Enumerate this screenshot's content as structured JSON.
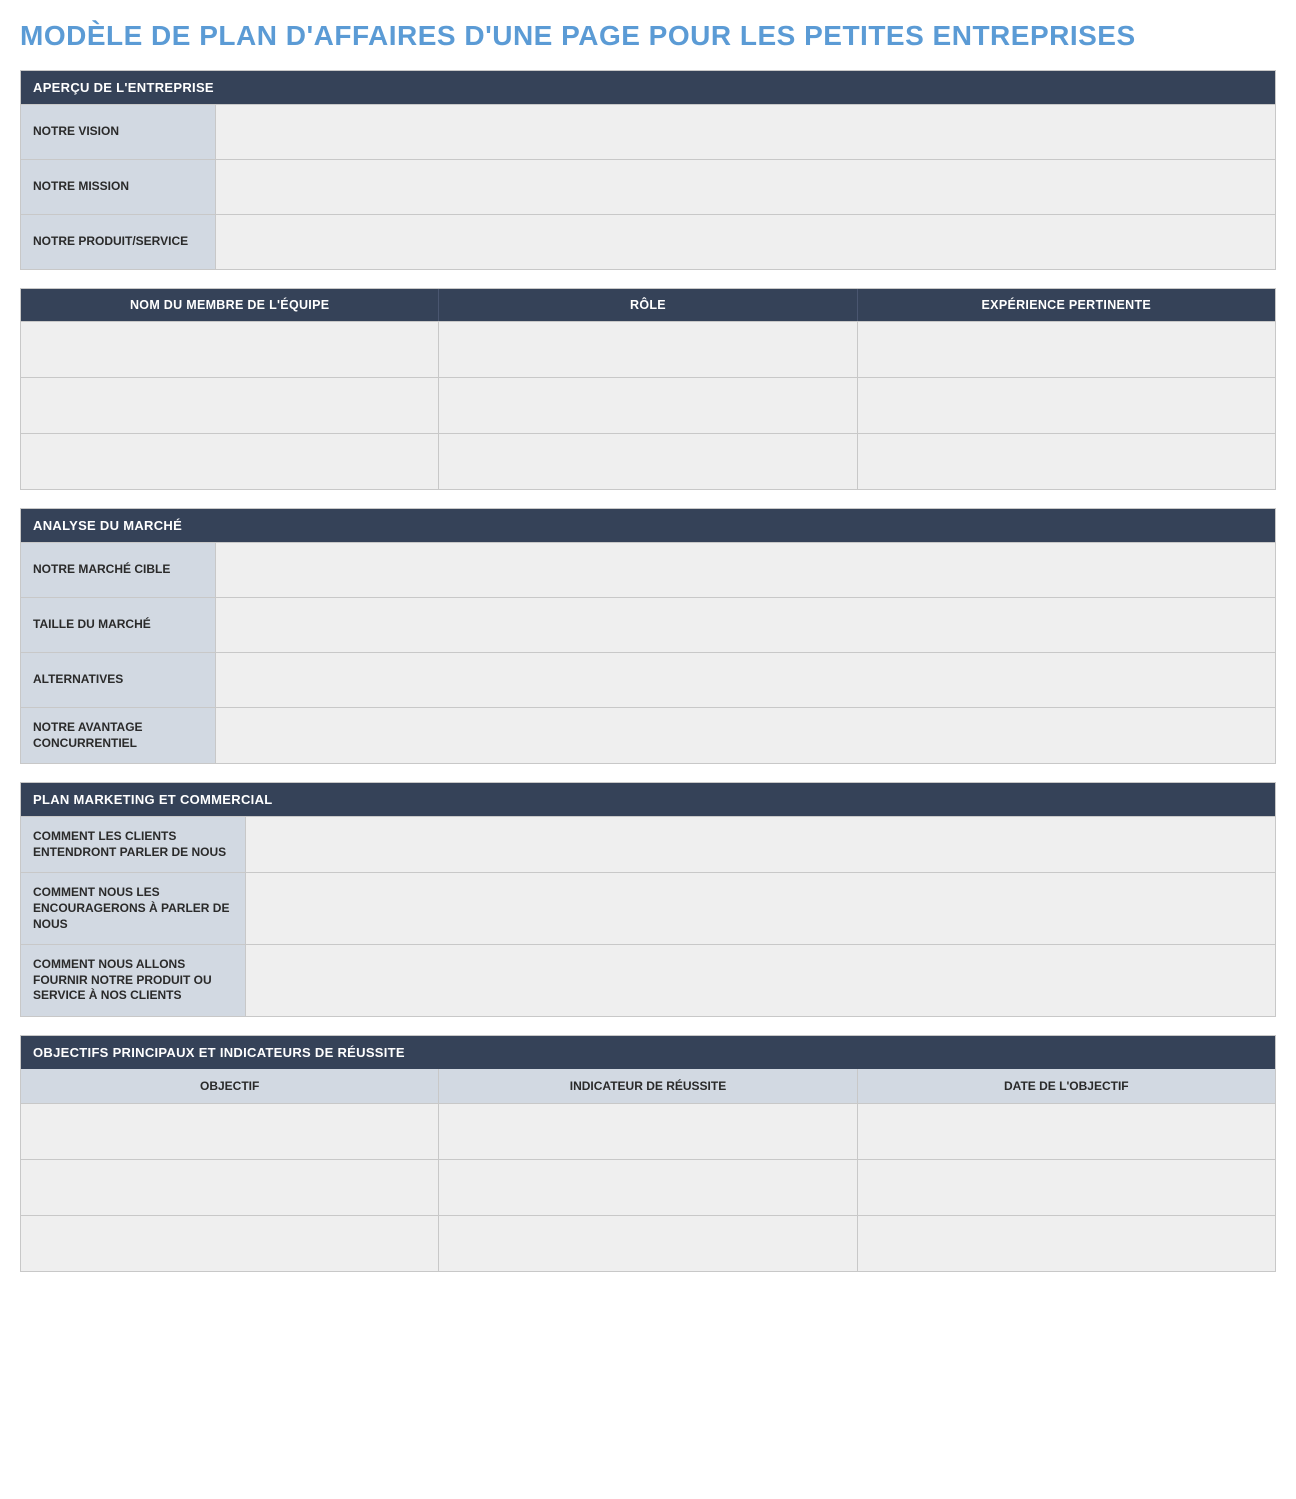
{
  "title": "MODÈLE DE PLAN D'AFFAIRES D'UNE PAGE POUR LES PETITES ENTREPRISES",
  "overview": {
    "header": "APERÇU DE L'ENTREPRISE",
    "rows": [
      {
        "label": "NOTRE VISION",
        "value": ""
      },
      {
        "label": "NOTRE MISSION",
        "value": ""
      },
      {
        "label": "NOTRE PRODUIT/SERVICE",
        "value": ""
      }
    ]
  },
  "team": {
    "columns": [
      "NOM DU MEMBRE DE L'ÉQUIPE",
      "RÔLE",
      "EXPÉRIENCE PERTINENTE"
    ],
    "rows": [
      [
        "",
        "",
        ""
      ],
      [
        "",
        "",
        ""
      ],
      [
        "",
        "",
        ""
      ]
    ]
  },
  "market": {
    "header": "ANALYSE DU MARCHÉ",
    "rows": [
      {
        "label": "NOTRE MARCHÉ CIBLE",
        "value": ""
      },
      {
        "label": "TAILLE DU MARCHÉ",
        "value": ""
      },
      {
        "label": "ALTERNATIVES",
        "value": ""
      },
      {
        "label": "NOTRE AVANTAGE CONCURRENTIEL",
        "value": ""
      }
    ]
  },
  "marketing": {
    "header": "PLAN MARKETING ET COMMERCIAL",
    "rows": [
      {
        "label": "COMMENT LES CLIENTS ENTENDRONT PARLER DE NOUS",
        "value": ""
      },
      {
        "label": "COMMENT NOUS LES ENCOURAGERONS À PARLER DE NOUS",
        "value": ""
      },
      {
        "label": "COMMENT NOUS ALLONS FOURNIR NOTRE PRODUIT OU SERVICE À NOS CLIENTS",
        "value": ""
      }
    ]
  },
  "objectives": {
    "header": "OBJECTIFS PRINCIPAUX ET INDICATEURS DE RÉUSSITE",
    "columns": [
      "OBJECTIF",
      "INDICATEUR DE RÉUSSITE",
      "DATE DE L'OBJECTIF"
    ],
    "rows": [
      [
        "",
        "",
        ""
      ],
      [
        "",
        "",
        ""
      ],
      [
        "",
        "",
        ""
      ]
    ]
  }
}
